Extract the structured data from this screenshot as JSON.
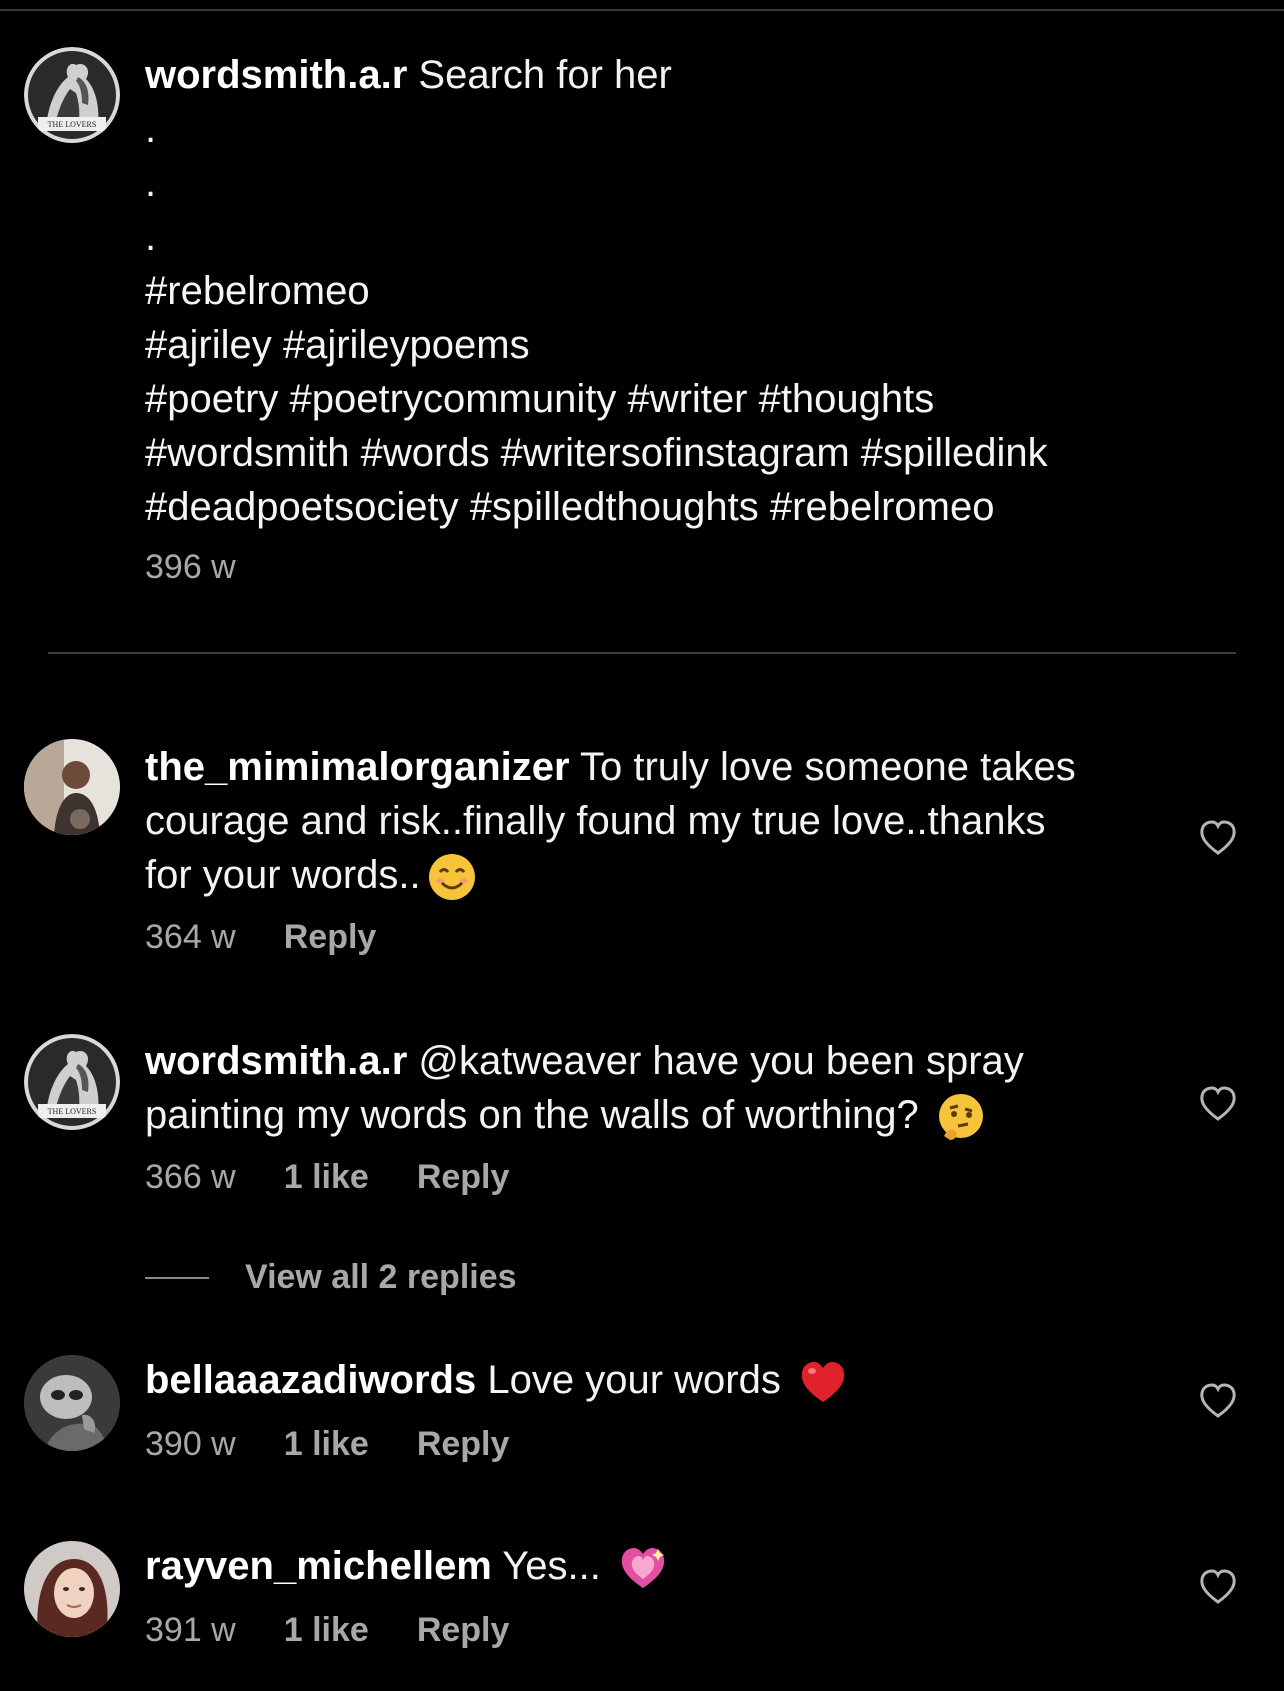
{
  "caption": {
    "username": "wordsmith.a.r",
    "text": "Search for her",
    "dots": [
      ".",
      ".",
      "."
    ],
    "hashtag_lines": [
      "#rebelromeo",
      "#ajriley #ajrileypoems",
      "#poetry #poetrycommunity #writer #thoughts",
      "#wordsmith #words #writersofinstagram #spilledink",
      "#deadpoetsociety #spilledthoughts #rebelromeo"
    ],
    "time": "396 w",
    "avatar_badge": "THE LOVERS"
  },
  "comments": [
    {
      "username": "the_mimimalorganizer",
      "lines": [
        "To truly love someone takes",
        "courage and risk..finally found my true love..thanks",
        "for your words.."
      ],
      "emoji": "smiling-face-icon",
      "time": "364 w",
      "reply": "Reply"
    },
    {
      "username": "wordsmith.a.r",
      "lines": [
        "@katweaver have you been spray",
        "painting my words on the walls of worthing?"
      ],
      "emoji": "thinking-face-icon",
      "time": "366 w",
      "likes": "1 like",
      "reply": "Reply",
      "avatar_badge": "THE LOVERS"
    },
    {
      "username": "bellaaazadiwords",
      "text": "Love your words",
      "emoji": "red-heart-icon",
      "time": "390 w",
      "likes": "1 like",
      "reply": "Reply"
    },
    {
      "username": "rayven_michellem",
      "text": "Yes...",
      "emoji": "sparkling-heart-icon",
      "time": "391 w",
      "likes": "1 like",
      "reply": "Reply"
    }
  ],
  "view_replies": "View all 2 replies"
}
